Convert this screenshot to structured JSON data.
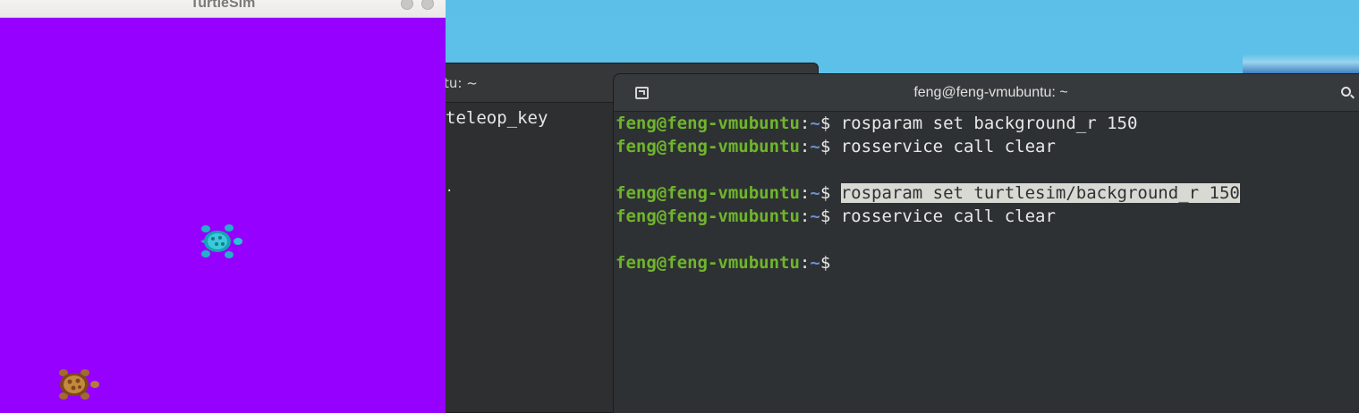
{
  "turtlesim": {
    "title": "TurtleSim",
    "background_color": "#9500ff"
  },
  "bg_terminal": {
    "title_fragment": "tu: ~",
    "lines": [
      "teleop_key",
      "",
      "",
      "."
    ]
  },
  "terminal": {
    "title": "feng@feng-vmubuntu: ~",
    "prompt_user": "feng@feng-vmubuntu",
    "prompt_colon": ":",
    "prompt_path": "~",
    "prompt_symbol": "$ ",
    "commands": [
      "rosparam set background_r 150",
      "rosservice call clear",
      "rosparam set turtlesim/background_r 150",
      "rosservice call clear"
    ]
  }
}
